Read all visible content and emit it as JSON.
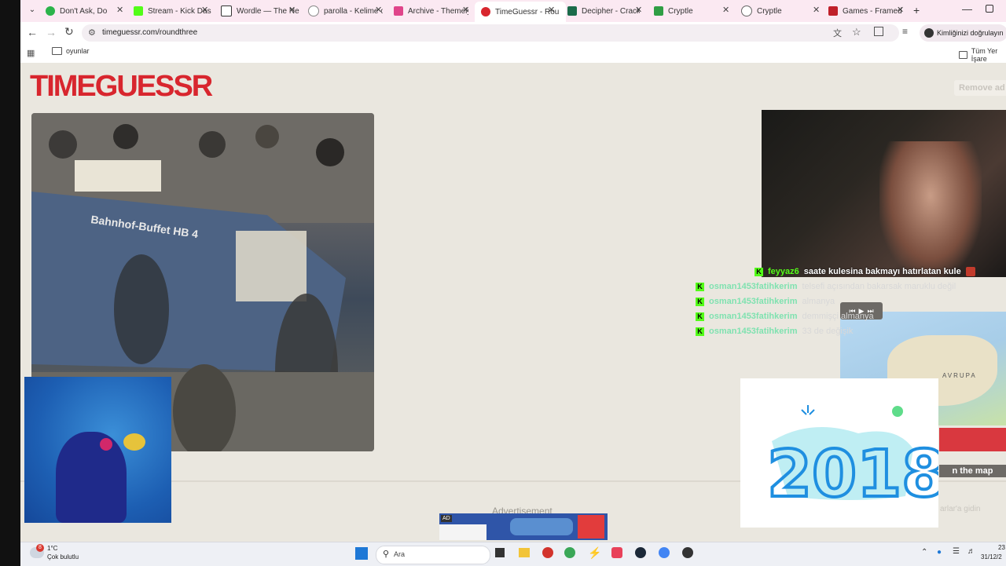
{
  "browser": {
    "tabs": [
      {
        "title": "Don't Ask, Do",
        "color": "#2bb34a"
      },
      {
        "title": "Stream - Kick Das",
        "color": "#53fc18"
      },
      {
        "title": "Wordle — The Ne",
        "color": "#333333"
      },
      {
        "title": "parolla - Kelime o",
        "color": "#888888"
      },
      {
        "title": "Archive - Themely",
        "color": "#e0448a"
      },
      {
        "title": "TimeGuessr - Rou",
        "color": "#d8262e"
      },
      {
        "title": "Decipher - Crack",
        "color": "#1b6b4a"
      },
      {
        "title": "Cryptle",
        "color": "#2f9e44"
      },
      {
        "title": "Cryptle",
        "color": "#666666"
      },
      {
        "title": "Games - Framed",
        "color": "#c0202a"
      }
    ],
    "new_tab": "+",
    "url": "timeguessr.com/roundthree",
    "profile_label": "Kimliğinizi doğrulayın",
    "bookmark_folder": "oyunlar",
    "all_bookmarks": "Tüm Yer İşare"
  },
  "page": {
    "logo": "TIMEGUESSR",
    "remove_ads": "Remove ad",
    "photo_sign": "Bahnhof-Buffet HB 4",
    "advertisement_label": "Advertisement",
    "ad_badge": "AD",
    "map_region_label": "AVRUPA",
    "map_button": "n the map",
    "faded_hint": "arlar'a gidin"
  },
  "chat": [
    {
      "user": "feyyaz6",
      "message": "saate kulesina bakmayı hatırlatan kule",
      "user_color": "#53fc18",
      "msg_color": "#ffffff"
    },
    {
      "user": "osman1453fatihkerim",
      "message": "telsefi açısından bakarsak maruklu değil",
      "user_color": "#7fe2b0",
      "msg_color": "#d8d8d8"
    },
    {
      "user": "osman1453fatihkerim",
      "message": "almanya",
      "user_color": "#7fe2b0",
      "msg_color": "#d8d8d8"
    },
    {
      "user": "osman1453fatihkerim",
      "message": "demmişçi almanya",
      "user_color": "#7fe2b0",
      "msg_color": "#d8d8d8"
    },
    {
      "user": "osman1453fatihkerim",
      "message": "33 de değişik",
      "user_color": "#7fe2b0",
      "msg_color": "#d8d8d8"
    }
  ],
  "sticker_text": "2018",
  "taskbar": {
    "weather_temp": "1°C",
    "weather_desc": "Çok bulutlu",
    "weather_badge": "8",
    "search_placeholder": "Ara",
    "time": "23",
    "date": "31/12/2"
  }
}
